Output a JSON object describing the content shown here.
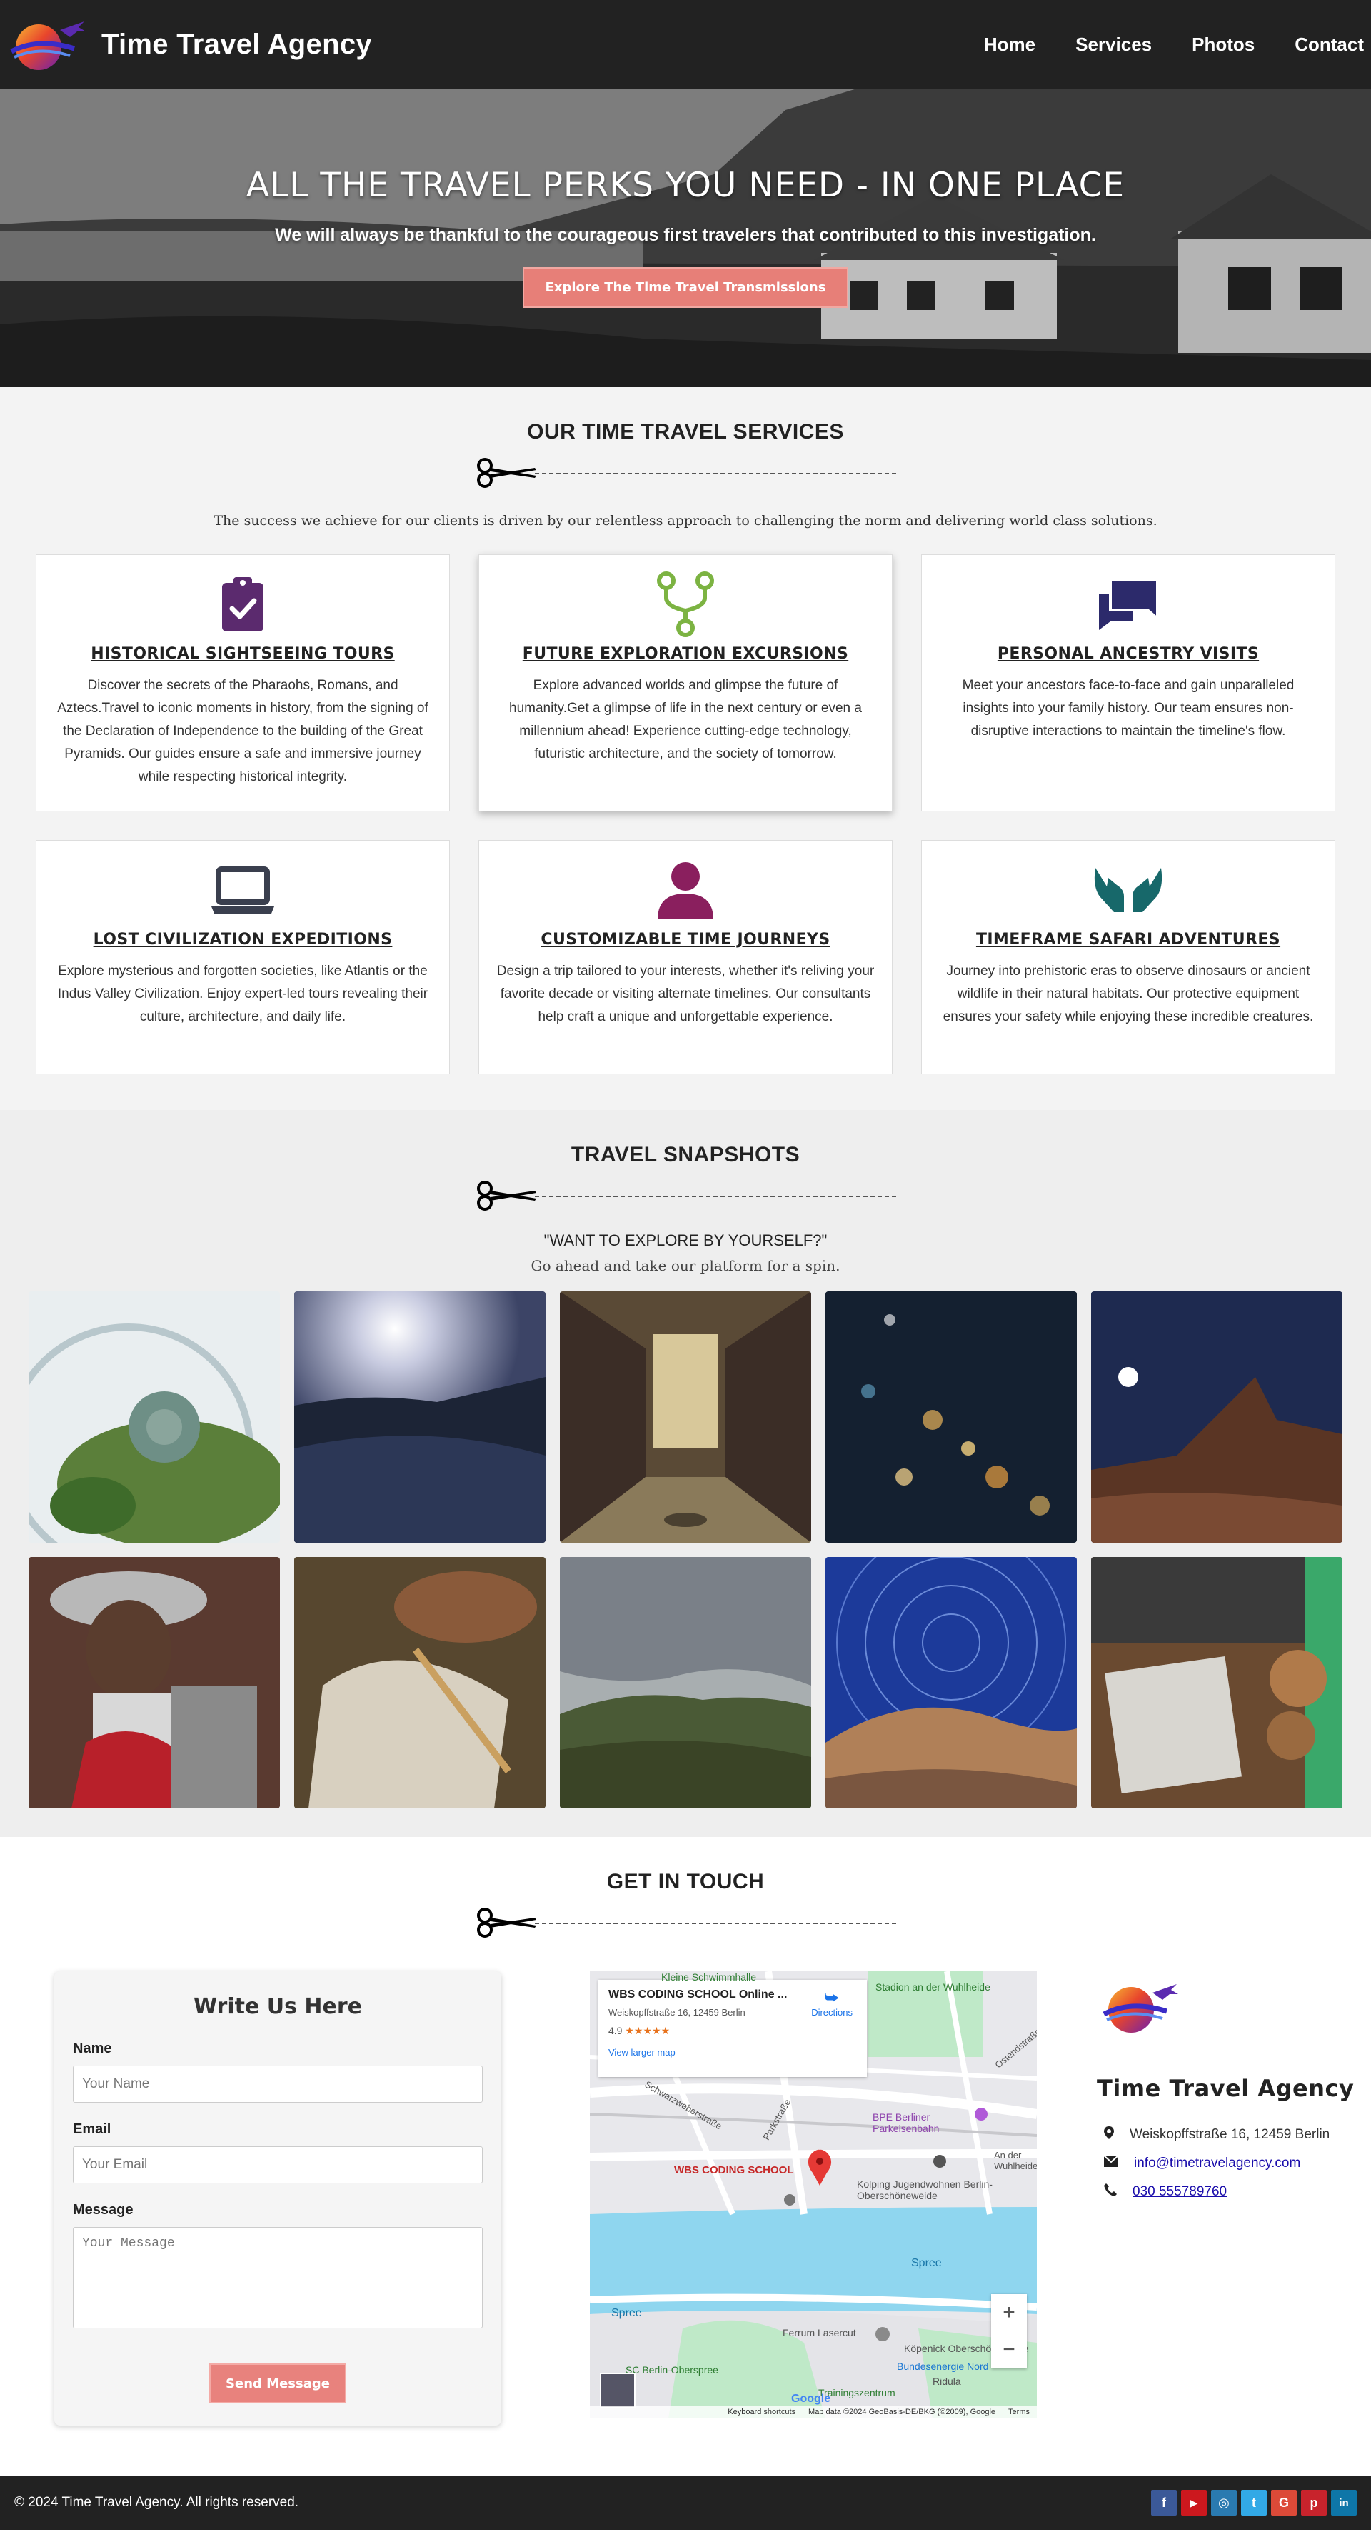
{
  "navbar": {
    "brand": "Time Travel Agency",
    "links": [
      "Home",
      "Services",
      "Photos",
      "Contact"
    ]
  },
  "hero": {
    "title": "ALL THE TRAVEL PERKS YOU NEED - IN ONE PLACE",
    "subtitle": "We will always be thankful to the courageous first travelers that contributed to this investigation.",
    "button": "Explore The Time Travel Transmissions"
  },
  "services": {
    "title": "OUR TIME TRAVEL SERVICES",
    "intro": "The success we achieve for our clients is driven by our relentless approach to challenging the norm and delivering world class solutions.",
    "cards": [
      {
        "icon": "clipboard-check-icon",
        "color": "#5b2a6e",
        "title": "HISTORICAL SIGHTSEEING TOURS",
        "text": "Discover the secrets of the Pharaohs, Romans, and Aztecs.Travel to iconic moments in history, from the signing of the Declaration of Independence to the building of the Great Pyramids. Our guides ensure a safe and immersive journey while respecting historical integrity."
      },
      {
        "icon": "code-branch-icon",
        "color": "#7cb342",
        "title": "FUTURE EXPLORATION EXCURSIONS",
        "text": "Explore advanced worlds and glimpse the future of humanity.Get a glimpse of life in the next century or even a millennium ahead! Experience cutting-edge technology, futuristic architecture, and the society of tomorrow."
      },
      {
        "icon": "comments-icon",
        "color": "#2c2a6b",
        "title": "PERSONAL ANCESTRY VISITS",
        "text": "Meet your ancestors face-to-face and gain unparalleled insights into your family history. Our team ensures non-disruptive interactions to maintain the timeline's flow."
      },
      {
        "icon": "laptop-icon",
        "color": "#3a3f4e",
        "title": "LOST CIVILIZATION EXPEDITIONS",
        "text": "Explore mysterious and forgotten societies, like Atlantis or the Indus Valley Civilization. Enjoy expert-led tours revealing their culture, architecture, and daily life."
      },
      {
        "icon": "user-icon",
        "color": "#8a1f5e",
        "title": "CUSTOMIZABLE TIME JOURNEYS",
        "text": "Design a trip tailored to your interests, whether it's reliving your favorite decade or visiting alternate timelines. Our consultants help craft a unique and unforgettable experience."
      },
      {
        "icon": "hands-icon",
        "color": "#17686a",
        "title": "TIMEFRAME SAFARI ADVENTURES",
        "text": "Journey into prehistoric eras to observe dinosaurs or ancient wildlife in their natural habitats. Our protective equipment ensures your safety while enjoying these incredible creatures."
      }
    ]
  },
  "snapshots": {
    "title": "TRAVEL SNAPSHOTS",
    "quote": "\"WANT TO EXPLORE BY YOURSELF?\"",
    "quote_sub": "Go ahead and take our platform for a spin.",
    "photos": [
      "terrarium-photo",
      "ocean-sunset-photo",
      "train-interior-photo",
      "city-lights-photo",
      "desert-night-photo",
      "guitar-player-photo",
      "traveler-hat-photo",
      "valley-landscape-photo",
      "star-trails-photo",
      "desk-sign-photo"
    ]
  },
  "contact": {
    "title": "GET IN TOUCH",
    "form": {
      "title": "Write Us Here",
      "name_label": "Name",
      "name_placeholder": "Your Name",
      "email_label": "Email",
      "email_placeholder": "Your Email",
      "message_label": "Message",
      "message_placeholder": "Your Message",
      "button": "Send Message"
    },
    "map": {
      "place_name": "WBS CODING SCHOOL Online ...",
      "address": "Weiskopffstraße 16, 12459 Berlin",
      "rating": "4.9",
      "stars": "★★★★★",
      "directions": "Directions",
      "larger_map": "View larger map",
      "pin_label": "WBS CODING SCHOOL",
      "labels": {
        "schwimmhalle": "Kleine Schwimmhalle",
        "stadion": "Stadion an der Wuhlheide",
        "bpe": "BPE Berliner Parkeisenbahn",
        "kolping": "Kolping Jugendwohnen Berlin-Oberschöneweide",
        "spree1": "Spree",
        "spree2": "Spree",
        "ferrum": "Ferrum Lasercut",
        "koepenick": "Köpenick Oberschöneweide",
        "bundesenergie": "Bundesenergie Nord",
        "ridula": "Ridula",
        "sc_berlin": "SC Berlin-Oberspree",
        "training": "Trainingszentrum",
        "google": "Google",
        "footer_shortcuts": "Keyboard shortcuts",
        "footer_data": "Map data ©2024 GeoBasis-DE/BKG (©2009), Google",
        "footer_terms": "Terms",
        "street1": "Schwarzweberstraße",
        "street2": "Parkstraße",
        "street3": "Ostendstraße",
        "street4": "An der Wuhlheide"
      },
      "zoom_in": "+",
      "zoom_out": "−"
    },
    "info": {
      "name": "Time Travel Agency",
      "address": "Weiskopffstraße 16, 12459 Berlin",
      "email": "info@timetravelagency.com",
      "phone": "030 555789760"
    }
  },
  "footer": {
    "copyright": "© 2024 Time Travel Agency. All rights reserved.",
    "socials": [
      {
        "name": "facebook-icon",
        "glyph": "f",
        "color": "#3b5998"
      },
      {
        "name": "youtube-icon",
        "glyph": "▶",
        "color": "#cc181e"
      },
      {
        "name": "instagram-icon",
        "glyph": "◎",
        "color": "#2a7ab0"
      },
      {
        "name": "twitter-icon",
        "glyph": "t",
        "color": "#32a9e6"
      },
      {
        "name": "google-plus-icon",
        "glyph": "G",
        "color": "#dc4a38"
      },
      {
        "name": "pinterest-icon",
        "glyph": "p",
        "color": "#c8232c"
      },
      {
        "name": "linkedin-icon",
        "glyph": "in",
        "color": "#0e76a8"
      }
    ]
  }
}
